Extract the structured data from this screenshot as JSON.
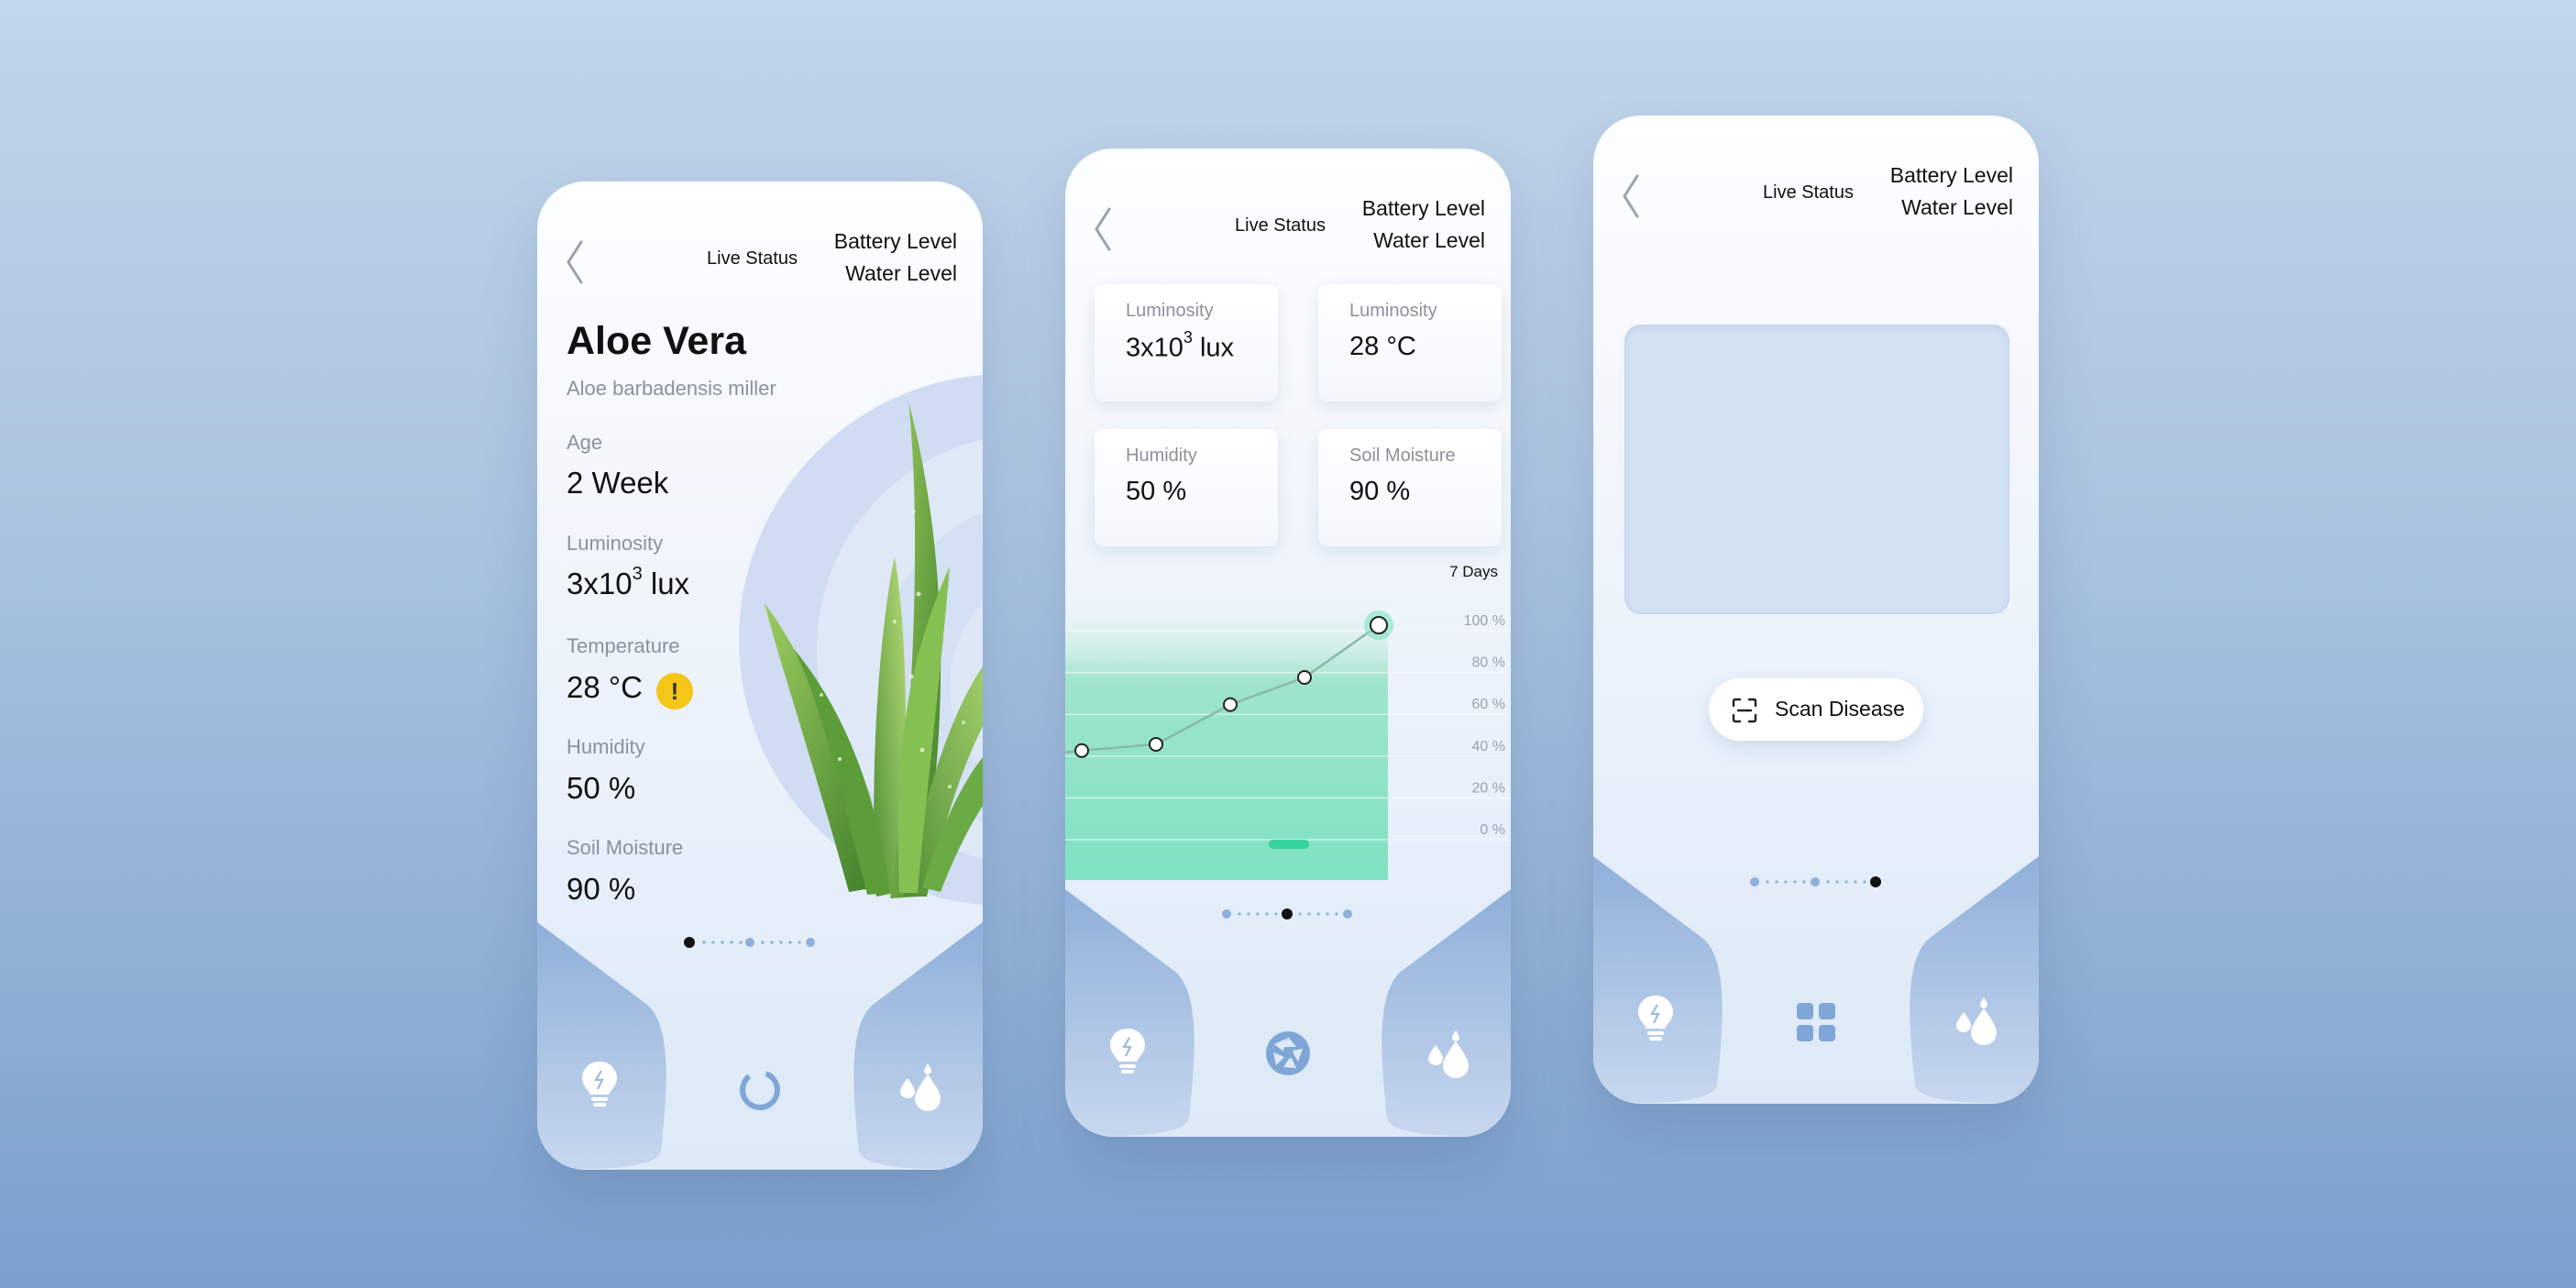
{
  "header": {
    "live_status": "Live Status",
    "battery_level": "Battery Level",
    "water_level": "Water Level"
  },
  "plant": {
    "name": "Aloe Vera",
    "scientific_name": "Aloe barbadensis miller",
    "age_label": "Age",
    "age_value": "2 Week",
    "luminosity_label": "Luminosity",
    "luminosity_base": "3x10",
    "luminosity_exp": "3",
    "luminosity_unit": " lux",
    "temperature_label": "Temperature",
    "temperature_value": "28 °C",
    "temperature_warning": "!",
    "humidity_label": "Humidity",
    "humidity_value": "50 %",
    "soil_label": "Soil Moisture",
    "soil_value": "90 %"
  },
  "cards": {
    "c1_label": "Luminosity",
    "c1_base": "3x10",
    "c1_exp": "3",
    "c1_unit": " lux",
    "c2_label": "Luminosity",
    "c2_value": "28 °C",
    "c3_label": "Humidity",
    "c3_value": "50 %",
    "c4_label": "Soil Moisture",
    "c4_value": "90 %"
  },
  "chart_data": {
    "type": "line",
    "title": "7 Days",
    "y_ticks": [
      "100 %",
      "80 %",
      "60 %",
      "40 %",
      "20 %",
      "0 %"
    ],
    "ylim": [
      0,
      100
    ],
    "values": [
      40,
      43,
      62,
      75,
      100
    ]
  },
  "scan": {
    "button_label": "Scan Disease"
  },
  "pagination": {
    "screen1_active": 0,
    "screen2_active": 1,
    "screen3_active": 2
  },
  "tabs": {
    "left_icon": "lightbulb-icon",
    "center_icons": [
      "loading-ring-icon",
      "aperture-icon",
      "grid-icon"
    ],
    "right_icon": "water-drops-icon"
  },
  "colors": {
    "accent_green": "#35d29c",
    "warning_yellow": "#f5c518",
    "icon_blue": "#7fa6d6"
  }
}
